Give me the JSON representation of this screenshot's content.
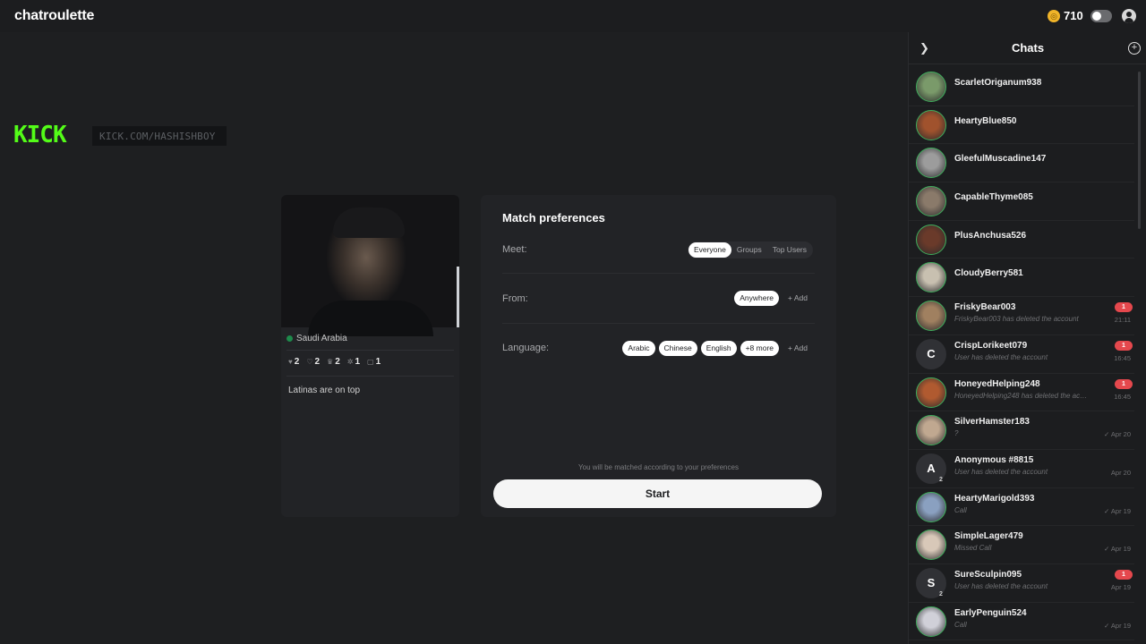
{
  "app": {
    "logo": "chatroulette"
  },
  "header": {
    "coin_symbol": "◎",
    "coin_count": "710"
  },
  "overlay": {
    "brand": "KICK",
    "url": "KICK.COM/HASHISHBOY"
  },
  "profile": {
    "country": "Saudi Arabia",
    "stats": [
      {
        "icon": "heart-icon",
        "value": "2"
      },
      {
        "icon": "heart-outline-icon",
        "value": "2"
      },
      {
        "icon": "crown-icon",
        "value": "2"
      },
      {
        "icon": "star-icon",
        "value": "1"
      },
      {
        "icon": "gift-icon",
        "value": "1"
      }
    ],
    "bio": "Latinas are on top"
  },
  "prefs": {
    "title": "Match preferences",
    "meet": {
      "label": "Meet:",
      "options": [
        "Everyone",
        "Groups",
        "Top Users"
      ],
      "selected": "Everyone"
    },
    "from": {
      "label": "From:",
      "value": "Anywhere",
      "add": "+ Add"
    },
    "language": {
      "label": "Language:",
      "values": [
        "Arabic",
        "Chinese",
        "English",
        "+8 more"
      ],
      "add": "+ Add"
    },
    "note": "You will be matched according to your preferences",
    "start": "Start"
  },
  "chats": {
    "title": "Chats",
    "items": [
      {
        "name": "ScarletOriganum938",
        "avatar": "photo",
        "color": "#7a9a6a"
      },
      {
        "name": "HeartyBlue850",
        "avatar": "photo",
        "color": "#a0522d"
      },
      {
        "name": "GleefulMuscadine147",
        "avatar": "photo",
        "color": "#9c9c9c"
      },
      {
        "name": "CapableThyme085",
        "avatar": "photo",
        "color": "#8a7a6a"
      },
      {
        "name": "PlusAnchusa526",
        "avatar": "photo",
        "color": "#6a3a2a"
      },
      {
        "name": "CloudyBerry581",
        "avatar": "photo",
        "color": "#c8c0b0"
      },
      {
        "name": "FriskyBear003",
        "avatar": "photo",
        "color": "#a08060",
        "sub": "FriskyBear003 has deleted the account",
        "badge": "1",
        "time": "21:11"
      },
      {
        "name": "CrispLorikeet079",
        "avatar": "letter",
        "letter": "C",
        "sub": "User has deleted the account",
        "badge": "1",
        "time": "16:45"
      },
      {
        "name": "HoneyedHelping248",
        "avatar": "photo",
        "color": "#b05a30",
        "sub": "HoneyedHelping248 has deleted the accou...",
        "badge": "1",
        "time": "16:45"
      },
      {
        "name": "SilverHamster183",
        "avatar": "photo",
        "color": "#c0a890",
        "sub": "?",
        "time": "✓ Apr 20"
      },
      {
        "name": "Anonymous #8815",
        "avatar": "letter",
        "letter": "A",
        "count": "2",
        "sub": "User has deleted the account",
        "time": "Apr 20"
      },
      {
        "name": "HeartyMarigold393",
        "avatar": "photo",
        "color": "#8aa0c0",
        "sub": "Call",
        "time": "✓ Apr 19"
      },
      {
        "name": "SimpleLager479",
        "avatar": "photo",
        "color": "#d8c8b8",
        "sub": "Missed Call",
        "time": "✓ Apr 19"
      },
      {
        "name": "SureSculpin095",
        "avatar": "letter",
        "letter": "S",
        "count": "2",
        "sub": "User has deleted the account",
        "badge": "1",
        "time": "Apr 19"
      },
      {
        "name": "EarlyPenguin524",
        "avatar": "photo",
        "color": "#d0d0d8",
        "sub": "Call",
        "time": "✓ Apr 19"
      }
    ]
  }
}
